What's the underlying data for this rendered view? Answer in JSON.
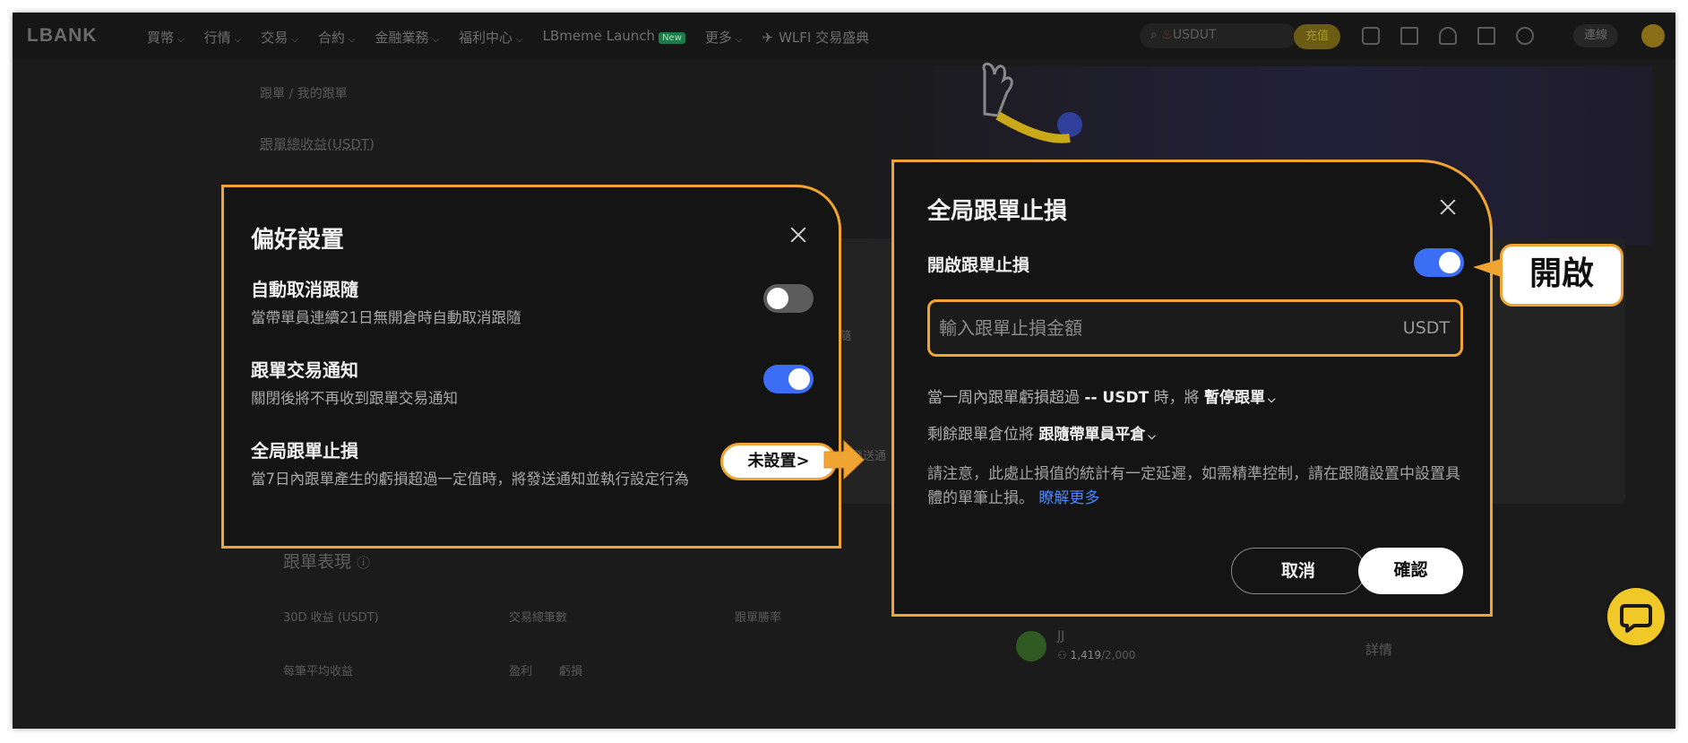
{
  "nav": {
    "logo": "LBANK",
    "items": [
      {
        "label": "買幣",
        "has_chevron": true
      },
      {
        "label": "行情",
        "has_chevron": true
      },
      {
        "label": "交易",
        "has_chevron": true
      },
      {
        "label": "合約",
        "has_chevron": true
      },
      {
        "label": "金融業務",
        "has_chevron": true
      },
      {
        "label": "福利中心",
        "has_chevron": true
      },
      {
        "label": "LBmeme Launch",
        "has_chevron": false
      },
      {
        "label": "更多",
        "has_chevron": true
      }
    ],
    "new_badge": "New",
    "promo": "WLFI 交易盛典",
    "search_placeholder": "USDUT",
    "deposit_label": "充值",
    "connect_label": "連線",
    "icons": [
      "wallet-icon",
      "document-icon",
      "bell-icon",
      "download-icon",
      "globe-icon"
    ]
  },
  "background": {
    "breadcrumb": "跟單 / 我的跟單",
    "total_profit_label": "跟單總收益(USDT)",
    "performance_title": "跟單表現",
    "col_30d": "30D 收益 (USDT)",
    "col_trades": "交易總筆數",
    "col_winrate": "跟單勝率",
    "col_avg": "每筆平均收益",
    "col_profit": "盈利",
    "col_loss": "虧損",
    "trader_name": "JJ",
    "trader_followers": "1,419",
    "trader_capacity": "/2,000",
    "details_label": "詳情",
    "partial_follow": "跟隨",
    "partial_send": "發送通"
  },
  "preferences_dialog": {
    "title": "偏好設置",
    "options": [
      {
        "title": "自動取消跟隨",
        "desc": "當帶單員連續21日無開倉時自動取消跟隨",
        "toggle": "off"
      },
      {
        "title": "跟單交易通知",
        "desc": "關閉後將不再收到跟單交易通知",
        "toggle": "on"
      },
      {
        "title": "全局跟單止損",
        "desc": "當7日內跟單產生的虧損超過一定值時，將發送通知並執行設定行為",
        "toggle": null
      }
    ],
    "not_set_label": "未設置>"
  },
  "stoploss_dialog": {
    "title": "全局跟單止損",
    "enable_label": "開啟跟單止損",
    "enable_state": "on",
    "input_placeholder": "輸入跟單止損金額",
    "input_value": "",
    "input_unit": "USDT",
    "rule_prefix": "當一周內跟單虧損超過",
    "rule_value": "-- USDT",
    "rule_middle": "時，將",
    "rule_action": "暫停跟單",
    "remaining_prefix": "剩餘跟單倉位將",
    "remaining_action": "跟隨帶單員平倉",
    "note": "請注意，此處止損值的統計有一定延遲，如需精準控制，請在跟隨設置中設置具體的單筆止損。",
    "learn_more": "瞭解更多",
    "cancel_label": "取消",
    "confirm_label": "確認"
  },
  "callouts": {
    "open_label": "開啟"
  },
  "colors": {
    "accent_orange": "#f0a431",
    "toggle_on": "#3b6ef5",
    "link_blue": "#4a86ff",
    "chat_yellow": "#f0c928"
  }
}
